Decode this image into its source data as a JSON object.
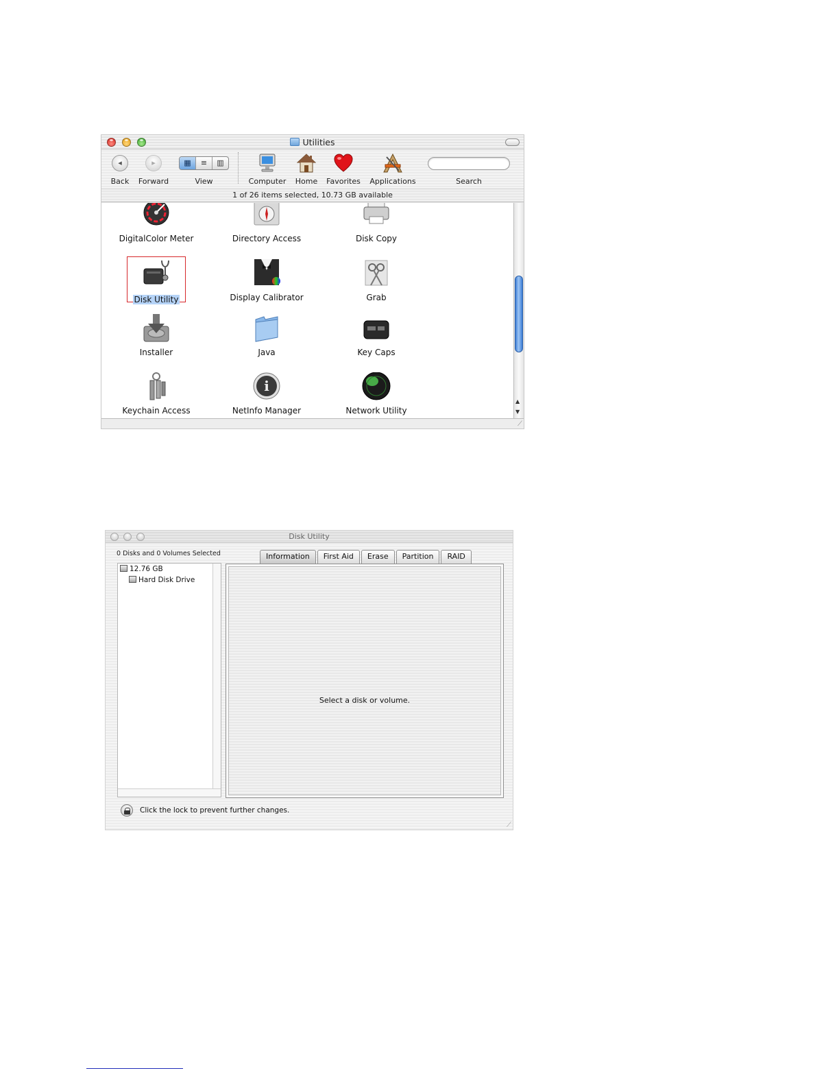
{
  "finder": {
    "title": "Utilities",
    "toolbar": {
      "back": "Back",
      "forward": "Forward",
      "view": "View",
      "computer": "Computer",
      "home": "Home",
      "favorites": "Favorites",
      "applications": "Applications",
      "search": "Search"
    },
    "status": "1 of 26 items selected, 10.73 GB available",
    "items": [
      {
        "label": "DigitalColor Meter",
        "icon": "digitalcolor-meter-icon"
      },
      {
        "label": "Directory Access",
        "icon": "directory-access-icon"
      },
      {
        "label": "Disk Copy",
        "icon": "disk-copy-icon"
      },
      {
        "label": "Disk Utility",
        "icon": "disk-utility-icon",
        "selected": true
      },
      {
        "label": "Display Calibrator",
        "icon": "display-calibrator-icon"
      },
      {
        "label": "Grab",
        "icon": "grab-icon"
      },
      {
        "label": "Installer",
        "icon": "installer-icon"
      },
      {
        "label": "Java",
        "icon": "java-folder-icon"
      },
      {
        "label": "Key Caps",
        "icon": "key-caps-icon"
      },
      {
        "label": "Keychain Access",
        "icon": "keychain-access-icon"
      },
      {
        "label": "NetInfo Manager",
        "icon": "netinfo-manager-icon"
      },
      {
        "label": "Network Utility",
        "icon": "network-utility-icon"
      }
    ],
    "colors": {
      "selection": "#b5d3f7",
      "highlight_frame": "#d6262a",
      "scroll_thumb": "#3c7dd6"
    }
  },
  "disk_utility": {
    "title": "Disk Utility",
    "selection_status": "0 Disks and 0 Volumes Selected",
    "disks": [
      {
        "label": "12.76 GB",
        "level": 0
      },
      {
        "label": "Hard Disk Drive",
        "level": 1
      }
    ],
    "tabs": [
      "Information",
      "First Aid",
      "Erase",
      "Partition",
      "RAID"
    ],
    "active_tab": "Information",
    "message": "Select a disk or volume.",
    "lock_message": "Click the lock to prevent further changes."
  }
}
